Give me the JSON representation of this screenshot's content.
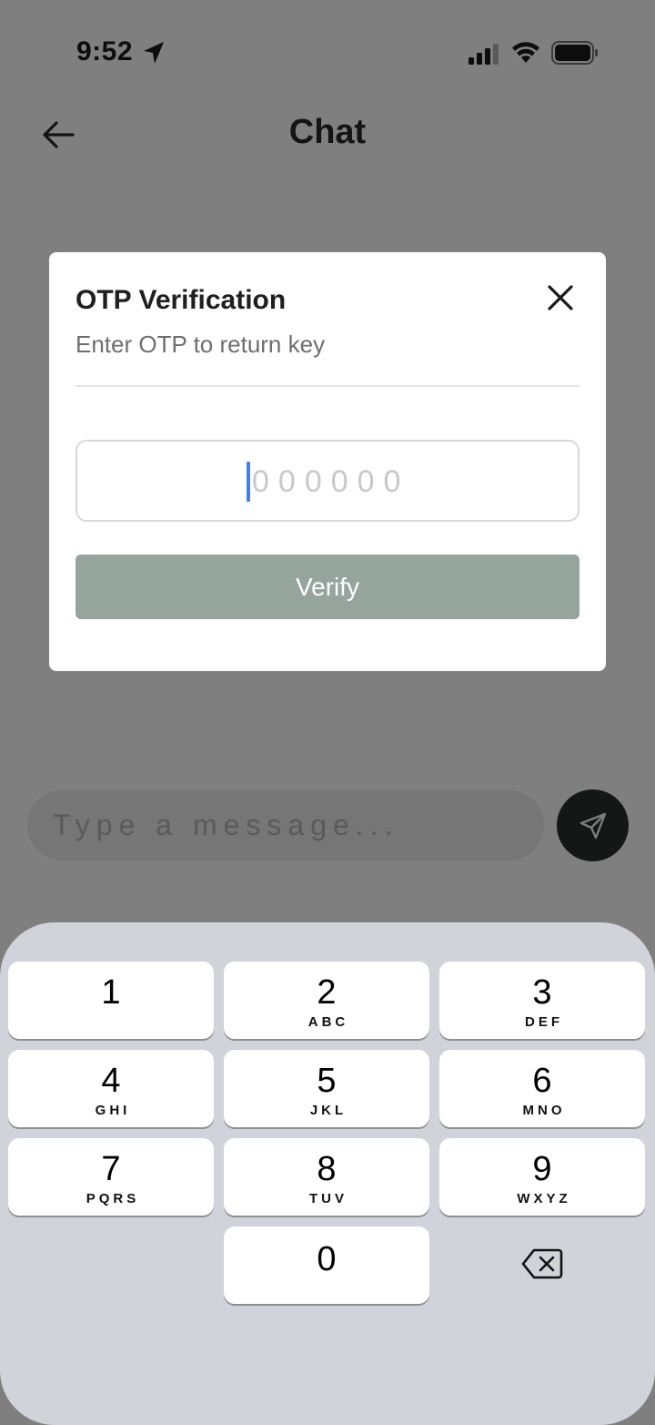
{
  "status_bar": {
    "time": "9:52"
  },
  "header": {
    "title": "Chat"
  },
  "modal": {
    "title": "OTP Verification",
    "subtitle": "Enter OTP to return key",
    "otp_placeholder": "000000",
    "verify_label": "Verify"
  },
  "composer": {
    "placeholder": "Type a message..."
  },
  "keypad": {
    "keys": [
      {
        "digit": "1",
        "letters": ""
      },
      {
        "digit": "2",
        "letters": "ABC"
      },
      {
        "digit": "3",
        "letters": "DEF"
      },
      {
        "digit": "4",
        "letters": "GHI"
      },
      {
        "digit": "5",
        "letters": "JKL"
      },
      {
        "digit": "6",
        "letters": "MNO"
      },
      {
        "digit": "7",
        "letters": "PQRS"
      },
      {
        "digit": "8",
        "letters": "TUV"
      },
      {
        "digit": "9",
        "letters": "WXYZ"
      },
      {
        "digit": "0",
        "letters": ""
      }
    ]
  },
  "colors": {
    "overlay": "#7f7f7f",
    "verify_button": "#95a59d",
    "send_button": "#151717",
    "keyboard_bg": "#d0d3d9",
    "caret": "#3a82f7"
  }
}
